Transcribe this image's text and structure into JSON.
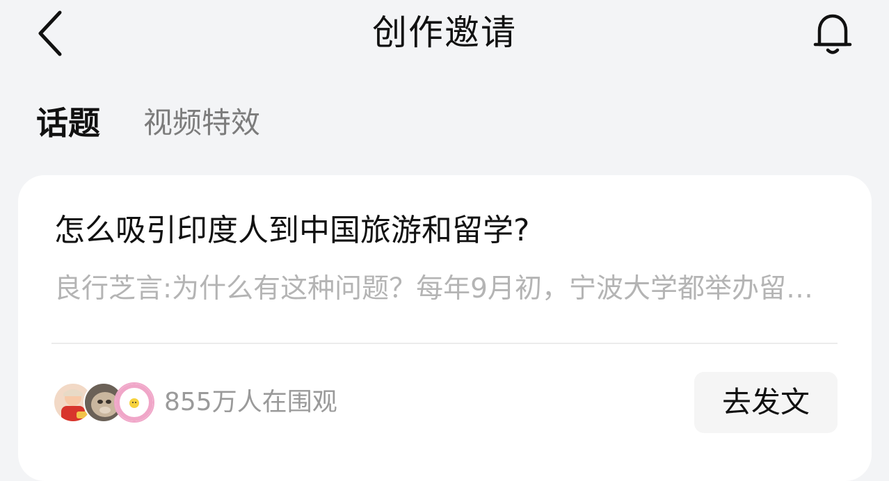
{
  "header": {
    "title": "创作邀请",
    "back_icon": "chevron-left-icon",
    "notification_icon": "bell-icon"
  },
  "tabs": [
    {
      "label": "话题",
      "active": true
    },
    {
      "label": "视频特效",
      "active": false
    }
  ],
  "card": {
    "title": "怎么吸引印度人到中国旅游和留学?",
    "excerpt": "良行芝言:为什么有这种问题？每年9月初，宁波大学都举办留学生开学典礼",
    "watchers_text": "855万人在围观",
    "avatars": [
      "child-avatar",
      "animal-avatar",
      "egg-avatar"
    ],
    "post_button_label": "去发文"
  },
  "colors": {
    "background": "#f3f4f6",
    "card_background": "#ffffff",
    "primary_text": "#111111",
    "inactive_tab": "#7c7c7c",
    "excerpt_text": "#b4b4b4",
    "meta_text": "#9a9a9a",
    "button_background": "#f5f5f5",
    "avatar_ring_pink": "#f0a6c8"
  }
}
